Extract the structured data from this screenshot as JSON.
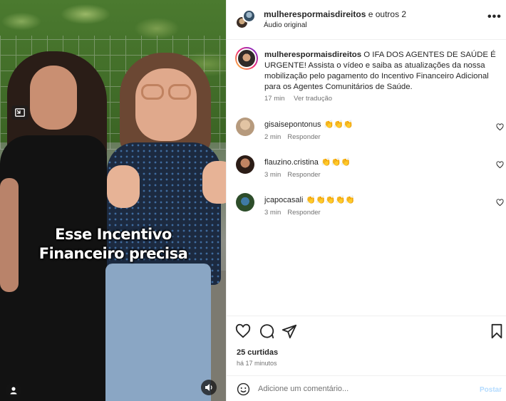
{
  "video": {
    "caption_line1": "Esse Incentivo",
    "caption_line2": "Financeiro precisa",
    "icons": [
      "picture-in-picture-icon",
      "user-tag-icon",
      "speaker-icon"
    ]
  },
  "header": {
    "account": "mulherespormaisdireitos",
    "collab_suffix": " e outros 2",
    "audio": "Áudio original",
    "more": "•••"
  },
  "post_caption": {
    "username": "mulherespormaisdireitos",
    "text": " O IFA DOS AGENTES DE SAÚDE É URGENTE! Assista o vídeo e saiba as atualizações da nossa mobilização pelo pagamento do Incentivo Financeiro Adicional para os Agentes Comunitários de Saúde.",
    "time": "17 min",
    "translate": "Ver tradução"
  },
  "comments": [
    {
      "username": "gisaisepontonus",
      "text": "👏👏👏",
      "time": "2 min",
      "reply": "Responder"
    },
    {
      "username": "flauzino.cristina",
      "text": "👏👏👏",
      "time": "3 min",
      "reply": "Responder"
    },
    {
      "username": "jcapocasali",
      "text": "👏👏👏👏👏",
      "time": "3 min",
      "reply": "Responder"
    }
  ],
  "footer": {
    "likes": "25 curtidas",
    "posted_ago": "há 17 minutos"
  },
  "composer": {
    "placeholder": "Adicione um comentário...",
    "post_label": "Postar"
  },
  "colors": {
    "text": "#262626",
    "muted": "#737373",
    "post_disabled": "#b3dbff",
    "divider": "#efefef"
  }
}
